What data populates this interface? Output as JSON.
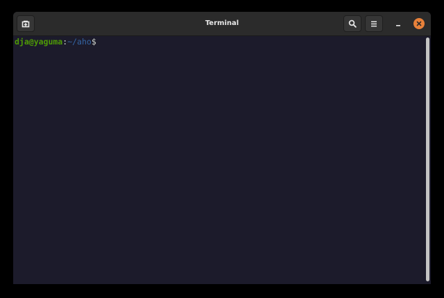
{
  "window": {
    "title": "Terminal"
  },
  "headerbar": {
    "new_tab_icon": "new-tab-icon",
    "search_icon": "search-icon",
    "menu_icon": "hamburger-menu-icon",
    "minimize_icon": "minimize-icon",
    "close_icon": "close-icon"
  },
  "terminal": {
    "prompt_user": "dja@yaguma",
    "prompt_sep": ":",
    "prompt_path": "~/aho",
    "prompt_symbol": "$"
  },
  "colors": {
    "background": "#1c1b2b",
    "headerbar": "#2b2b2b",
    "user_host": "#4e9a06",
    "path": "#3465a4",
    "text": "#d3d7cf",
    "close_button": "#e8813a",
    "scrollbar_thumb": "#c4c4c4"
  }
}
